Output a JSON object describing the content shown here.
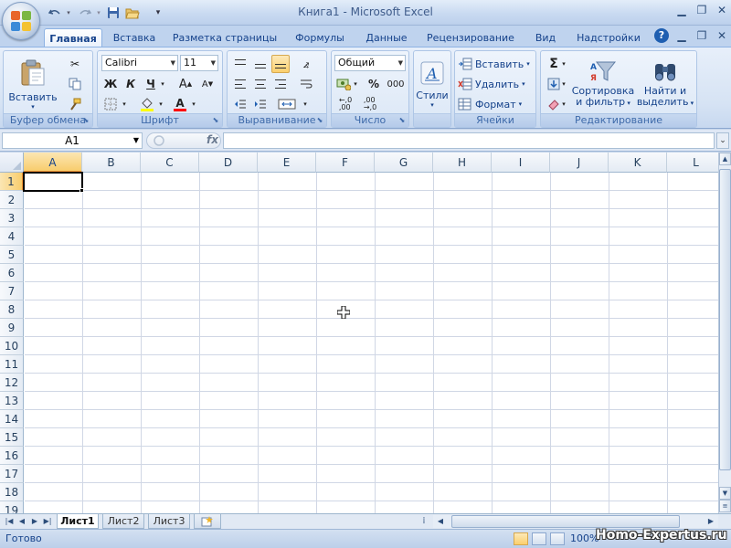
{
  "window": {
    "title": "Книга1 - Microsoft Excel"
  },
  "qat": {
    "undo_icon": "undo-icon",
    "redo_icon": "redo-icon",
    "save_icon": "save-icon",
    "open_icon": "open-folder-icon"
  },
  "tabs": [
    {
      "label": "Главная",
      "active": true
    },
    {
      "label": "Вставка"
    },
    {
      "label": "Разметка страницы"
    },
    {
      "label": "Формулы"
    },
    {
      "label": "Данные"
    },
    {
      "label": "Рецензирование"
    },
    {
      "label": "Вид"
    },
    {
      "label": "Надстройки"
    }
  ],
  "ribbon": {
    "clipboard": {
      "label": "Буфер обмена",
      "paste": "Вставить"
    },
    "font": {
      "label": "Шрифт",
      "family": "Calibri",
      "size": "11",
      "bold": "Ж",
      "italic": "К",
      "underline": "Ч",
      "grow": "A",
      "shrink": "A",
      "fill_color": "#ffff00",
      "font_color": "#ff0000"
    },
    "alignment": {
      "label": "Выравнивание"
    },
    "number": {
      "label": "Число",
      "format": "Общий",
      "percent": "%",
      "thousands": "000"
    },
    "styles": {
      "label": "Стили"
    },
    "cells": {
      "label": "Ячейки",
      "insert": "Вставить",
      "delete": "Удалить",
      "format": "Формат"
    },
    "editing": {
      "label": "Редактирование",
      "sort_line1": "Сортировка",
      "sort_line2": "и фильтр",
      "find_line1": "Найти и",
      "find_line2": "выделить",
      "sum": "Σ"
    }
  },
  "formula_bar": {
    "name_box": "A1",
    "fx": "fx",
    "value": ""
  },
  "grid": {
    "columns": [
      "A",
      "B",
      "C",
      "D",
      "E",
      "F",
      "G",
      "H",
      "I",
      "J",
      "K",
      "L"
    ],
    "rows": [
      "1",
      "2",
      "3",
      "4",
      "5",
      "6",
      "7",
      "8",
      "9",
      "10",
      "11",
      "12",
      "13",
      "14",
      "15",
      "16",
      "17",
      "18",
      "19"
    ],
    "active_cell": "A1"
  },
  "sheets": [
    {
      "label": "Лист1",
      "active": true
    },
    {
      "label": "Лист2"
    },
    {
      "label": "Лист3"
    }
  ],
  "status": {
    "text": "Готово",
    "zoom": "100%"
  },
  "watermark": "Homo-Expertus.ru"
}
